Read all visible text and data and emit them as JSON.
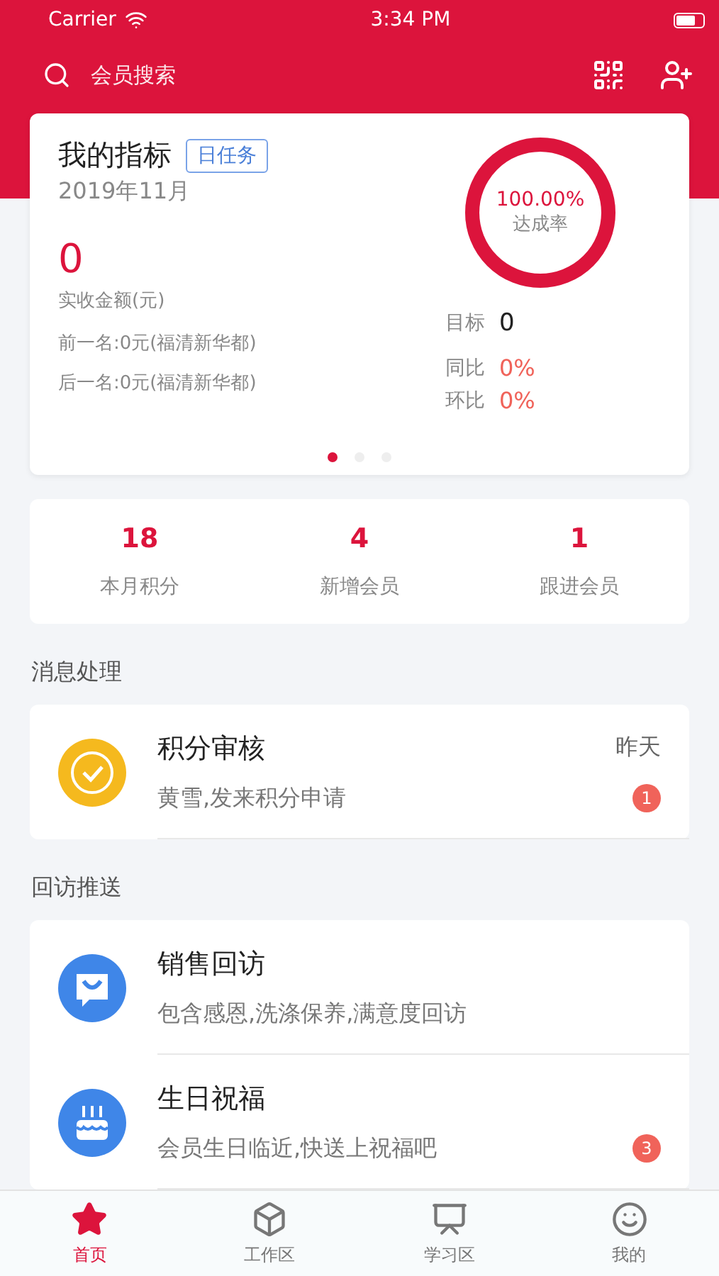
{
  "status_bar": {
    "carrier": "Carrier",
    "time": "3:34 PM"
  },
  "header": {
    "search_placeholder": "会员搜索"
  },
  "target_card": {
    "title": "我的指标",
    "tag": "日任务",
    "month": "2019年11月",
    "amount": "0",
    "amount_label": "实收金额(元)",
    "prev_rank": "前一名:0元(福清新华都)",
    "next_rank": "后一名:0元(福清新华都)",
    "ring": {
      "level": 1,
      "value": "100.00%",
      "label": "达成率"
    },
    "goal_label": "目标",
    "goal_value": "0",
    "compare": [
      {
        "label": "同比",
        "value": "0%"
      },
      {
        "label": "环比",
        "value": "0%"
      }
    ],
    "pager": [
      {
        "selected": true
      },
      {
        "selected": false
      },
      {
        "selected": false
      }
    ]
  },
  "stats": [
    {
      "value": "18",
      "label": "本月积分"
    },
    {
      "value": "4",
      "label": "新增会员"
    },
    {
      "value": "1",
      "label": "跟进会员"
    }
  ],
  "sections": [
    {
      "title": "消息处理",
      "items": [
        {
          "kind": "review",
          "title": "积分审核",
          "subtitle": "黄雪,发来积分申请",
          "time": "昨天",
          "badge": "1"
        }
      ]
    },
    {
      "title": "回访推送",
      "items": [
        {
          "kind": "chat",
          "title": "销售回访",
          "subtitle": "包含感恩,洗涤保养,满意度回访"
        },
        {
          "kind": "cake",
          "title": "生日祝福",
          "subtitle": "会员生日临近,快送上祝福吧",
          "badge": "3"
        }
      ]
    }
  ],
  "tab_bar": [
    {
      "kind": "star",
      "label": "首页",
      "selected": true
    },
    {
      "kind": "box",
      "label": "工作区",
      "selected": false
    },
    {
      "kind": "board",
      "label": "学习区",
      "selected": false
    },
    {
      "kind": "smile",
      "label": "我的",
      "selected": false
    }
  ]
}
